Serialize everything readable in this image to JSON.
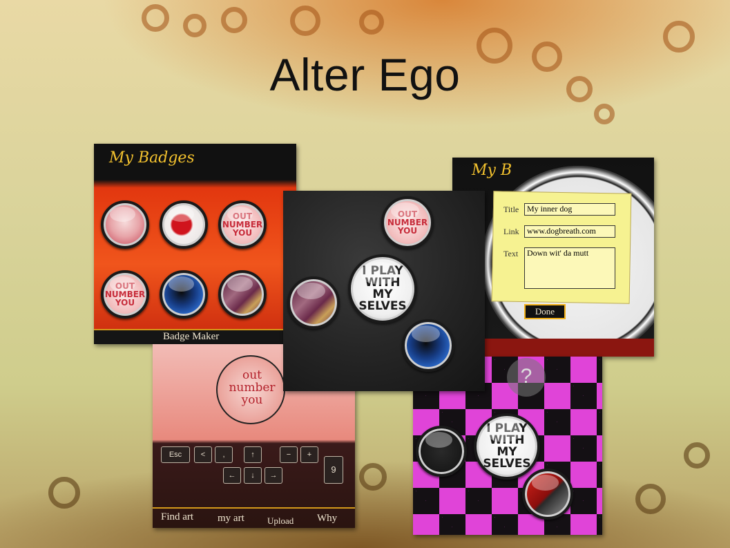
{
  "slide": {
    "title": "Alter Ego"
  },
  "my_badges": {
    "heading": "My Badges",
    "badges": [
      {
        "name": "skull"
      },
      {
        "name": "red-splat"
      },
      {
        "name": "out-number-you",
        "text": "OUT NUMBER YOU"
      },
      {
        "name": "out-number-you",
        "text": "OUT NUMBER YOU"
      },
      {
        "name": "blue-heart"
      },
      {
        "name": "purple-grass"
      }
    ],
    "footer_label": "Badge Maker"
  },
  "badge_scatter": {
    "center_badge_text": "I PLAY WITH MY SELVES",
    "small_badge_text": "OUT NUMBER YOU"
  },
  "post_form": {
    "heading": "My B",
    "title_label": "Title",
    "title_value": "My inner dog",
    "link_label": "Link",
    "link_value": "www.dogbreath.com",
    "text_label": "Text",
    "text_value": "Down wit' da mutt",
    "done_button": "Done"
  },
  "badge_editor": {
    "badge_text": "out number you",
    "keys": [
      "Esc",
      "<",
      ",",
      "↑",
      "−",
      "+",
      "←",
      "↓",
      "→",
      "9"
    ],
    "nav": [
      "Find art",
      "my art",
      "Upload",
      "Why"
    ]
  },
  "checker_board": {
    "help_icon_text": "?",
    "badge_text": "I PLAY WITH MY SELVES"
  },
  "colors": {
    "badge_bg_red": "#e2370f",
    "checker_pink": "#e044d8",
    "screen_black": "#111111"
  }
}
